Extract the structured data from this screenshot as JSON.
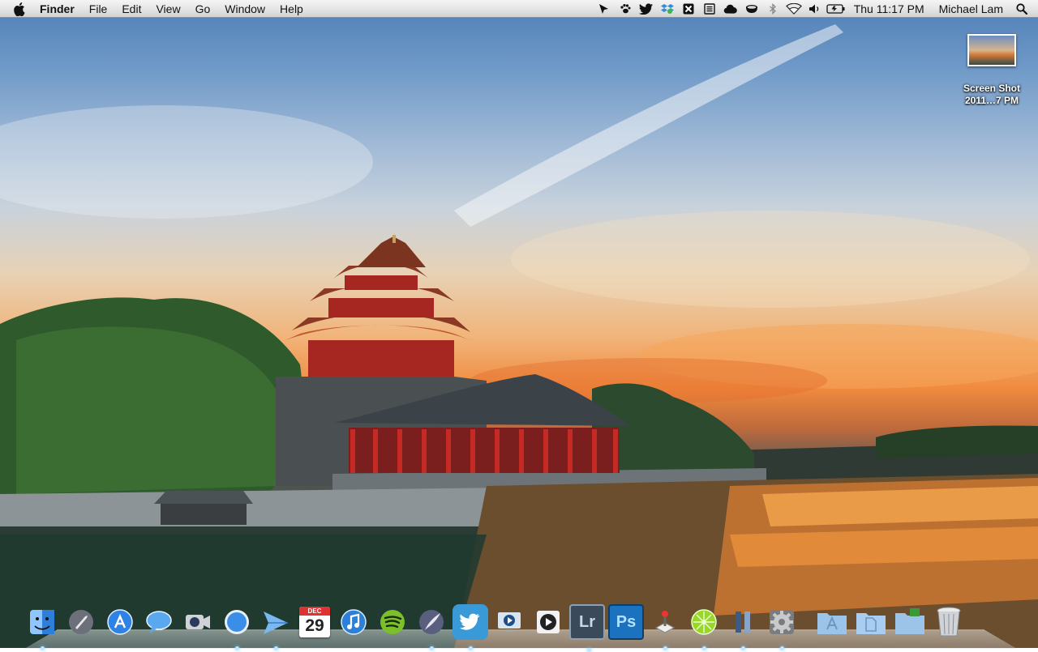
{
  "menubar": {
    "apple_icon": "apple-icon",
    "app_name": "Finder",
    "menus": [
      "File",
      "Edit",
      "View",
      "Go",
      "Window",
      "Help"
    ],
    "status_icons": [
      "pointer-icon",
      "paw-icon",
      "twitter-bird-icon",
      "dropbox-icon",
      "x-box-icon",
      "notes-icon",
      "cloud-icon",
      "coffee-cup-icon",
      "bluetooth-icon",
      "wifi-icon",
      "volume-icon",
      "battery-icon"
    ],
    "clock": "Thu 11:17 PM",
    "user": "Michael Lam",
    "spotlight_icon": "magnifier-icon"
  },
  "desktop": {
    "icons": [
      {
        "label": "Screen Shot\n2011…7 PM"
      }
    ]
  },
  "dock": {
    "items": [
      {
        "name": "finder",
        "icon": "finder-face-icon",
        "color": "#3a8be0",
        "running": true
      },
      {
        "name": "launchpad",
        "icon": "rocket-icon",
        "color": "#8a8f9a",
        "running": false
      },
      {
        "name": "app-store",
        "icon": "app-store-icon",
        "color": "#2f7fe4",
        "running": false
      },
      {
        "name": "ichat",
        "icon": "speech-bubble-icon",
        "color": "#3f8fe8",
        "running": false
      },
      {
        "name": "facetime",
        "icon": "camera-icon",
        "color": "#6a6f78",
        "running": false
      },
      {
        "name": "safari",
        "icon": "compass-icon",
        "color": "#3b8ee8",
        "running": true
      },
      {
        "name": "sparrow",
        "icon": "paper-plane-icon",
        "color": "#5aa5ef",
        "running": true
      },
      {
        "name": "ical",
        "icon": "calendar-icon",
        "color": "#e8e8e8",
        "running": false,
        "month": "DEC",
        "day": "29"
      },
      {
        "name": "itunes",
        "icon": "music-note-icon",
        "color": "#2e7fd8",
        "running": false
      },
      {
        "name": "spotify",
        "icon": "spotify-icon",
        "color": "#7bbf2a",
        "running": false
      },
      {
        "name": "sparrow-2",
        "icon": "quill-icon",
        "color": "#6b6f90",
        "running": true
      },
      {
        "name": "tweetie",
        "icon": "bird-icon",
        "color": "#3a9ad8",
        "running": true
      },
      {
        "name": "quicktime",
        "icon": "play-monitor-icon",
        "color": "#2f5f9a",
        "running": false
      },
      {
        "name": "dvd-player",
        "icon": "play-disc-icon",
        "color": "#9a9ea6",
        "running": false
      },
      {
        "name": "lightroom",
        "icon": "lr-icon",
        "color": "#3a4a5a",
        "running": true,
        "letters": "Lr"
      },
      {
        "name": "photoshop",
        "icon": "ps-icon",
        "color": "#1b73c0",
        "running": false,
        "letters": "Ps"
      },
      {
        "name": "transmit",
        "icon": "joystick-icon",
        "color": "#d8d8d8",
        "running": true
      },
      {
        "name": "limechat",
        "icon": "lime-icon",
        "color": "#9ad62a",
        "running": true
      },
      {
        "name": "columns",
        "icon": "columns-icon",
        "color": "#3a3a4a",
        "running": true
      },
      {
        "name": "system-preferences",
        "icon": "gear-icon",
        "color": "#8a8c90",
        "running": true
      },
      {
        "name": "applications-folder",
        "icon": "applications-folder-icon",
        "color": "#9cc4e8",
        "running": false
      },
      {
        "name": "documents-folder",
        "icon": "documents-folder-icon",
        "color": "#a8cdf0",
        "running": false
      },
      {
        "name": "downloads-folder",
        "icon": "downloads-folder-icon",
        "color": "#9cc4e8",
        "running": false
      },
      {
        "name": "trash",
        "icon": "trash-icon",
        "color": "#c8ccd0",
        "running": false
      }
    ]
  }
}
